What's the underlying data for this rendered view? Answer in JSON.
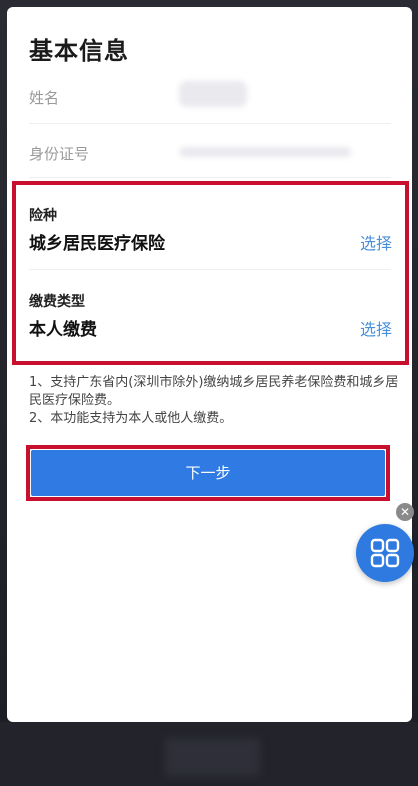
{
  "header": {
    "title": "基本信息"
  },
  "basic_info": {
    "name_label": "姓名",
    "id_label": "身份证号"
  },
  "insurance": {
    "type_label": "险种",
    "type_value": "城乡居民医疗保险",
    "type_select": "选择",
    "payment_label": "缴费类型",
    "payment_value": "本人缴费",
    "payment_select": "选择"
  },
  "notes": {
    "line1": "1、支持广东省内(深圳市除外)缴纳城乡居民养老保险费和城乡居民医疗保险费。",
    "line2": "2、本功能支持为本人或他人缴费。"
  },
  "actions": {
    "next_label": "下一步"
  },
  "floating": {
    "close_glyph": "✕"
  },
  "colors": {
    "accent": "#2f7be3",
    "highlight": "#c8102e",
    "link": "#4a8fd8"
  }
}
